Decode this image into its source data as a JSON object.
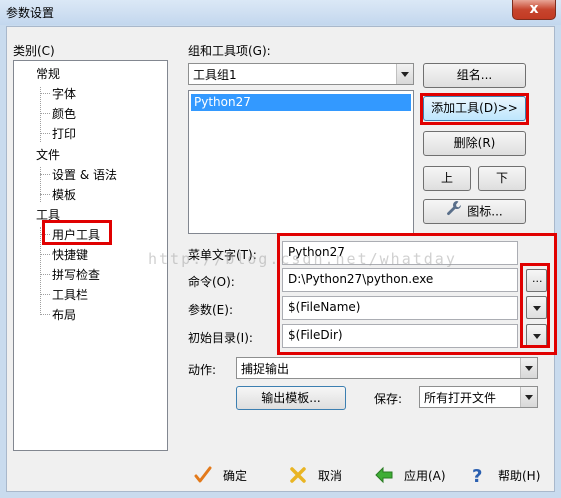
{
  "window": {
    "title": "参数设置",
    "close_glyph": "x"
  },
  "categories": {
    "label": "类别(C)",
    "items": [
      {
        "label": "常规",
        "level": 0
      },
      {
        "label": "字体",
        "level": 1
      },
      {
        "label": "颜色",
        "level": 1
      },
      {
        "label": "打印",
        "level": 1
      },
      {
        "label": "文件",
        "level": 0
      },
      {
        "label": "设置 & 语法",
        "level": 1
      },
      {
        "label": "模板",
        "level": 1
      },
      {
        "label": "工具",
        "level": 0
      },
      {
        "label": "用户工具",
        "level": 1,
        "selected": true
      },
      {
        "label": "快捷键",
        "level": 1
      },
      {
        "label": "拼写检查",
        "level": 1
      },
      {
        "label": "工具栏",
        "level": 1
      },
      {
        "label": "布局",
        "level": 1
      }
    ]
  },
  "tool_group": {
    "label": "组和工具项(G):",
    "selected": "工具组1",
    "list_items": [
      "Python27"
    ]
  },
  "buttons": {
    "group_name": "组名...",
    "add_tool": "添加工具(D)>>",
    "delete": "删除(R)",
    "up": "上",
    "down": "下",
    "icon": "图标...",
    "output_template": "输出模板...",
    "browse": "..."
  },
  "fields": {
    "menu_text": {
      "label": "菜单文字(T):",
      "value": "Python27"
    },
    "command": {
      "label": "命令(O):",
      "value": "D:\\Python27\\python.exe"
    },
    "args": {
      "label": "参数(E):",
      "value": "$(FileName)"
    },
    "init_dir": {
      "label": "初始目录(I):",
      "value": "$(FileDir)"
    }
  },
  "action": {
    "label": "动作:",
    "value": "捕捉输出"
  },
  "save": {
    "label": "保存:",
    "value": "所有打开文件"
  },
  "watermark": "http://blog.csdn.net/whatday",
  "footer": {
    "ok": "确定",
    "cancel": "取消",
    "apply": "应用(A)",
    "help": "帮助(H)"
  },
  "colors": {
    "highlight": "#e00000",
    "selection": "#3399ff"
  },
  "icons": {
    "ok": "check-icon",
    "cancel": "cross-icon",
    "apply": "arrow-left-icon",
    "help": "question-icon",
    "tool_icon": "wrench-icon"
  }
}
